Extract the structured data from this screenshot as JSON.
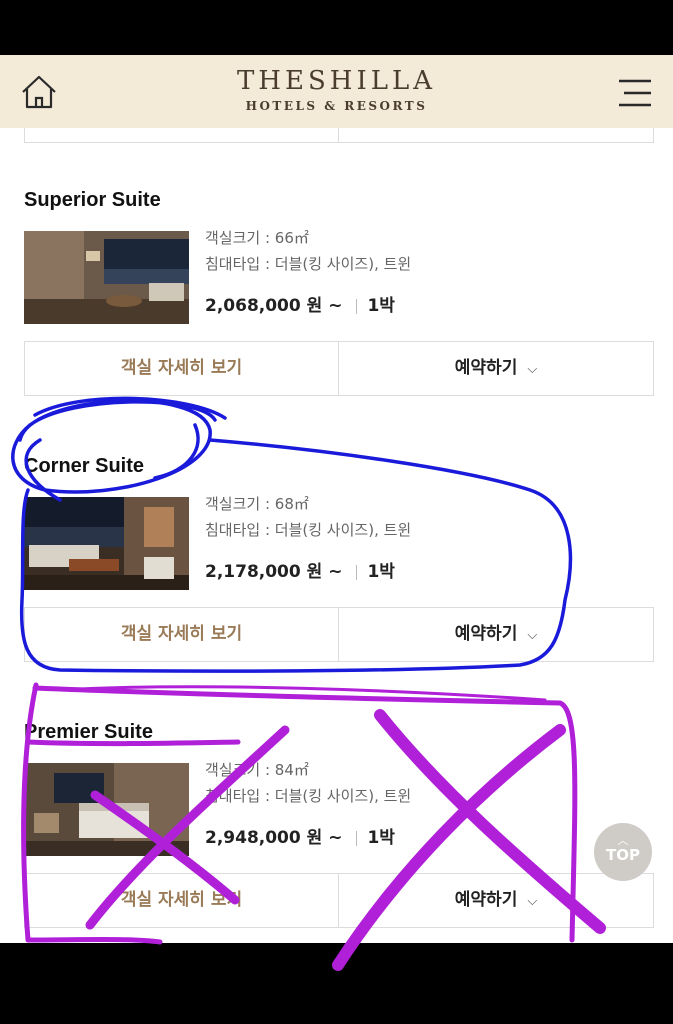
{
  "header": {
    "logo_main": "THESHILLA",
    "logo_sub": "HOTELS & RESORTS"
  },
  "rooms": [
    {
      "title": "Superior Suite",
      "size_line": "객실크기 : 66㎡",
      "bed_line": "침대타입 : 더블(킹 사이즈), 트윈",
      "price": "2,068,000 원 ~",
      "nights": "1박",
      "detail_label": "객실 자세히 보기",
      "book_label": "예약하기"
    },
    {
      "title": "Corner Suite",
      "size_line": "객실크기 : 68㎡",
      "bed_line": "침대타입 : 더블(킹 사이즈), 트윈",
      "price": "2,178,000 원 ~",
      "nights": "1박",
      "detail_label": "객실 자세히 보기",
      "book_label": "예약하기"
    },
    {
      "title": "Premier Suite",
      "size_line": "객실크기 : 84㎡",
      "bed_line": "침대타입 : 더블(킹 사이즈), 트윈",
      "price": "2,948,000 원 ~",
      "nights": "1박",
      "detail_label": "객실 자세히 보기",
      "book_label": "예약하기"
    }
  ],
  "top_button": {
    "label": "TOP"
  },
  "icons": {
    "home": "home-icon",
    "menu": "hamburger-menu-icon",
    "chevron": "chevron-down-icon",
    "top_arrow": "chevron-up-icon"
  },
  "colors": {
    "header_bg": "#f3ead8",
    "logo": "#4a3d2e",
    "detail_text": "#9a7b58",
    "blue_markup": "#1a1adb",
    "purple_markup": "#b020d8"
  }
}
